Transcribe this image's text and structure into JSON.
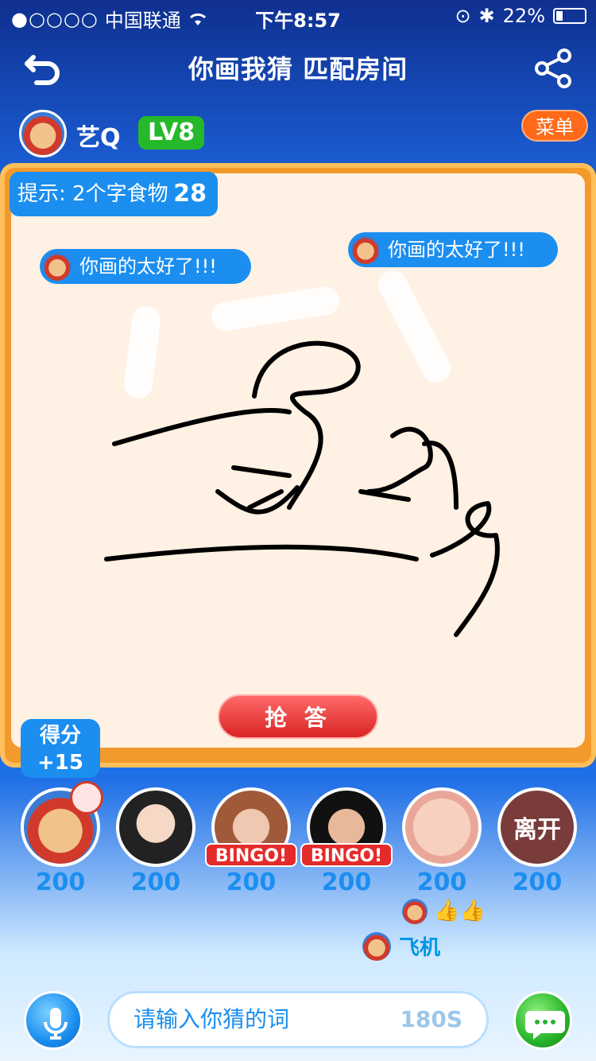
{
  "status_bar": {
    "signal": "●○○○○",
    "carrier": "中国联通",
    "wifi_icon": "wifi-icon",
    "time": "下午8:57",
    "battery": "22%"
  },
  "header": {
    "title": "你画我猜   匹配房间",
    "back_icon": "back-arrow-icon",
    "share_icon": "share-icon"
  },
  "user": {
    "name": "艺Q",
    "level": "LV8",
    "menu_label": "菜单"
  },
  "hint": {
    "label": "提示: 2个字食物",
    "timer": "28"
  },
  "bubbles": [
    {
      "text": "你画的太好了!!!"
    },
    {
      "text": "你画的太好了!!!"
    }
  ],
  "answer_button": "抢 答",
  "score_badge": {
    "label": "得分",
    "value": "+15"
  },
  "players": [
    {
      "score": "200",
      "status": ""
    },
    {
      "score": "200",
      "status": ""
    },
    {
      "score": "200",
      "status": "BINGO!"
    },
    {
      "score": "200",
      "status": "BINGO!"
    },
    {
      "score": "200",
      "status": ""
    },
    {
      "score": "200",
      "status": "离开"
    }
  ],
  "gift": {
    "name": "飞机",
    "thumbs": "👍👍"
  },
  "input": {
    "placeholder": "请输入你猜的词",
    "timer": "180S"
  },
  "colors": {
    "accent_blue": "#1b8ef0",
    "accent_green": "#26b82b",
    "accent_orange": "#ff6a1a",
    "accent_red": "#d92424"
  }
}
